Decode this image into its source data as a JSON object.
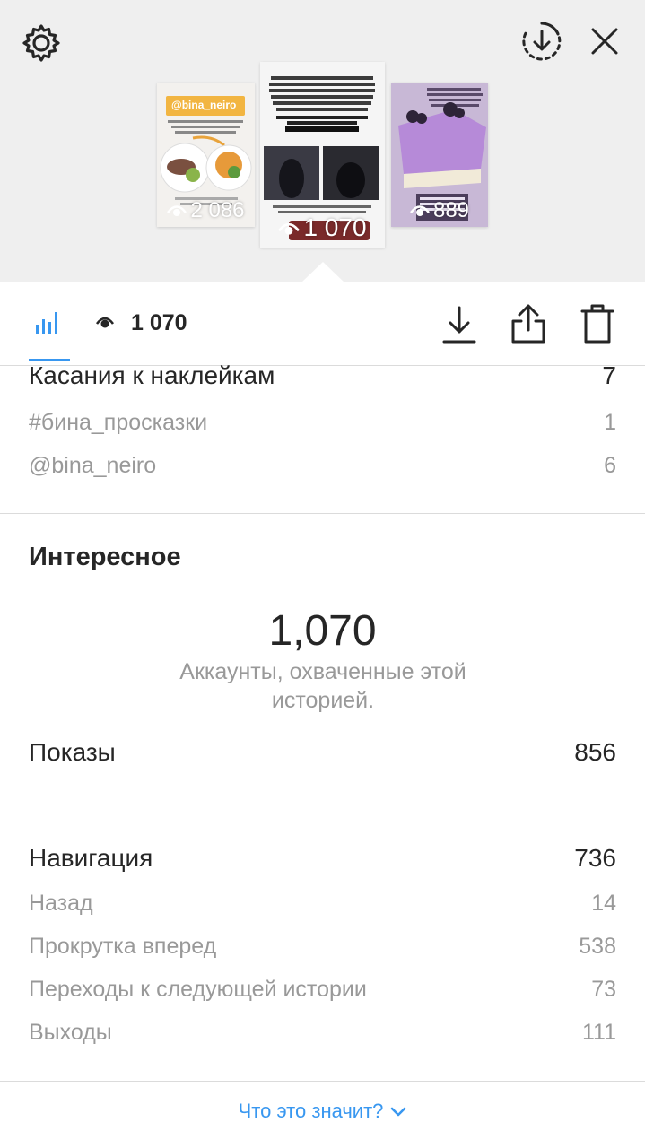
{
  "stories": [
    {
      "views": "2 086",
      "handle": "@bina_neiro"
    },
    {
      "views": "1 070",
      "tag": "#бина_проскази",
      "text": "Можете почитать их по специальному хэштегу"
    },
    {
      "views": "889"
    }
  ],
  "toolbar": {
    "views_count": "1 070"
  },
  "sticker_taps": {
    "label": "Касания к наклейкам",
    "value": "7",
    "items": [
      {
        "label": "#бина_просказки",
        "value": "1"
      },
      {
        "label": "@bina_neiro",
        "value": "6"
      }
    ]
  },
  "discovery": {
    "title": "Интересное",
    "reach": "1,070",
    "reach_desc": "Аккаунты, охваченные этой историей.",
    "impressions_label": "Показы",
    "impressions_value": "856"
  },
  "navigation": {
    "label": "Навигация",
    "value": "736",
    "items": [
      {
        "label": "Назад",
        "value": "14"
      },
      {
        "label": "Прокрутка вперед",
        "value": "538"
      },
      {
        "label": "Переходы к следующей истории",
        "value": "73"
      },
      {
        "label": "Выходы",
        "value": "111"
      }
    ]
  },
  "footer": {
    "link": "Что это значит?"
  },
  "colors": {
    "accent": "#3897f0",
    "text": "#262626",
    "muted": "#999999",
    "divider": "#dbdbdb",
    "top_bg": "#efefef"
  },
  "icons": [
    "gear-icon",
    "download-circle-icon",
    "close-icon",
    "insights-bars-icon",
    "eye-icon",
    "download-icon",
    "share-icon",
    "trash-icon",
    "chevron-down-icon"
  ]
}
